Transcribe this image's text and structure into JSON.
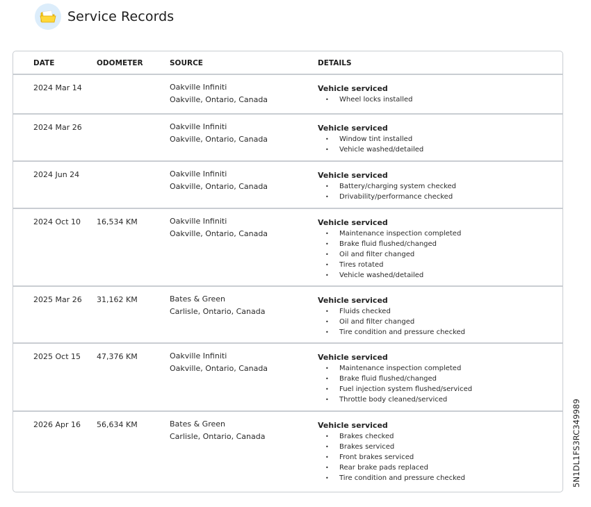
{
  "header": {
    "title": "Service Records",
    "icon": "folder-icon"
  },
  "table": {
    "columns": {
      "date": "DATE",
      "odometer": "ODOMETER",
      "source": "SOURCE",
      "details": "DETAILS"
    },
    "rows": [
      {
        "date": "2024 Mar 14",
        "odometer": "",
        "source_name": "Oakville Infiniti",
        "source_location": "Oakville, Ontario, Canada",
        "details_title": "Vehicle serviced",
        "items": [
          "Wheel locks installed"
        ]
      },
      {
        "date": "2024 Mar 26",
        "odometer": "",
        "source_name": "Oakville Infiniti",
        "source_location": "Oakville, Ontario, Canada",
        "details_title": "Vehicle serviced",
        "items": [
          "Window tint installed",
          "Vehicle washed/detailed"
        ]
      },
      {
        "date": "2024 Jun 24",
        "odometer": "",
        "source_name": "Oakville Infiniti",
        "source_location": "Oakville, Ontario, Canada",
        "details_title": "Vehicle serviced",
        "items": [
          "Battery/charging system checked",
          "Drivability/performance checked"
        ]
      },
      {
        "date": "2024 Oct 10",
        "odometer": "16,534 KM",
        "source_name": "Oakville Infiniti",
        "source_location": "Oakville, Ontario, Canada",
        "details_title": "Vehicle serviced",
        "items": [
          "Maintenance inspection completed",
          "Brake fluid flushed/changed",
          "Oil and filter changed",
          "Tires rotated",
          "Vehicle washed/detailed"
        ]
      },
      {
        "date": "2025 Mar 26",
        "odometer": "31,162 KM",
        "source_name": "Bates & Green",
        "source_location": "Carlisle, Ontario, Canada",
        "details_title": "Vehicle serviced",
        "items": [
          "Fluids checked",
          "Oil and filter changed",
          "Tire condition and pressure checked"
        ]
      },
      {
        "date": "2025 Oct 15",
        "odometer": "47,376 KM",
        "source_name": "Oakville Infiniti",
        "source_location": "Oakville, Ontario, Canada",
        "details_title": "Vehicle serviced",
        "items": [
          "Maintenance inspection completed",
          "Brake fluid flushed/changed",
          "Fuel injection system flushed/serviced",
          "Throttle body cleaned/serviced"
        ]
      },
      {
        "date": "2026 Apr 16",
        "odometer": "56,634 KM",
        "source_name": "Bates & Green",
        "source_location": "Carlisle, Ontario, Canada",
        "details_title": "Vehicle serviced",
        "items": [
          "Brakes checked",
          "Brakes serviced",
          "Front brakes serviced",
          "Rear brake pads replaced",
          "Tire condition and pressure checked"
        ]
      }
    ]
  },
  "vin": "5N1DL1FS3RC349989"
}
